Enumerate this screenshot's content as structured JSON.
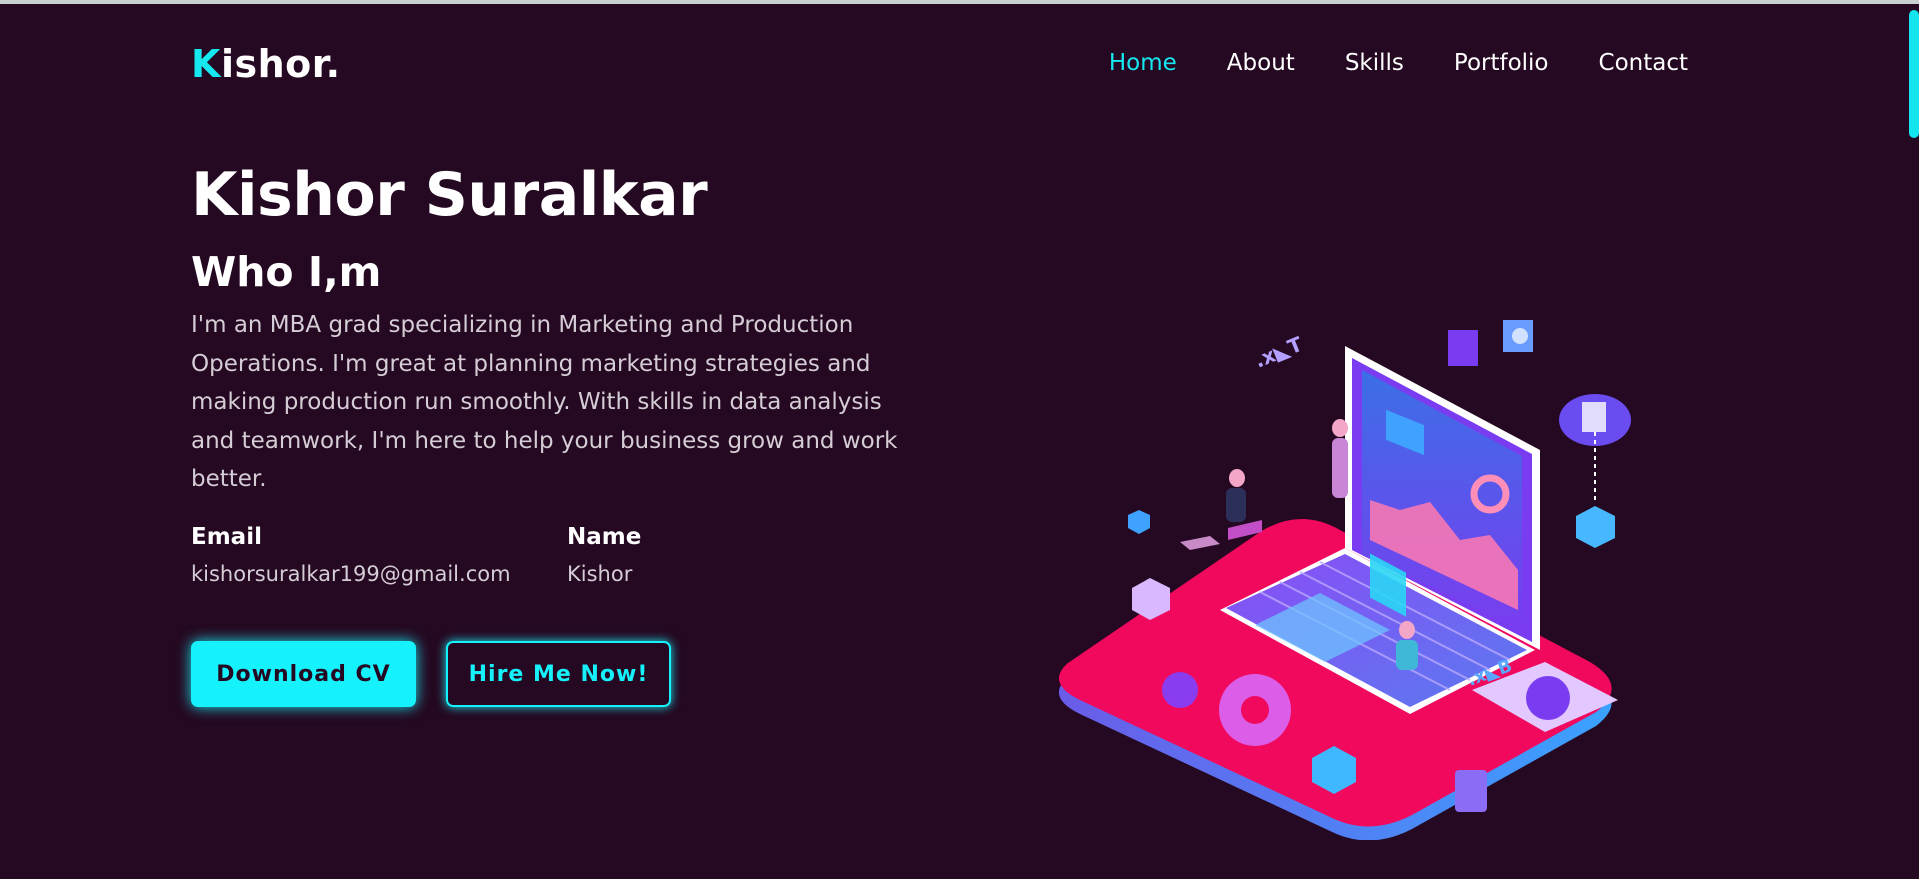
{
  "brand": {
    "first_letter": "K",
    "rest": "ishor."
  },
  "nav": {
    "items": [
      "Home",
      "About",
      "Skills",
      "Portfolio",
      "Contact"
    ],
    "active": "Home"
  },
  "hero": {
    "name": "Kishor Suralkar",
    "subtitle": "Who I,m",
    "bio": "I'm an MBA grad specializing in Marketing and Production Operations. I'm great at planning marketing strategies and making production run smoothly. With skills in data analysis and teamwork, I'm here to help your business grow and work better."
  },
  "info": {
    "email_label": "Email",
    "email_value": "kishorsuralkar199@gmail.com",
    "name_label": "Name",
    "name_value": "Kishor"
  },
  "buttons": {
    "download": "Download CV",
    "hire": "Hire Me Now!"
  },
  "colors": {
    "background": "#250821",
    "accent": "#16e8f0",
    "platform": "#f0095d",
    "laptop": "#7a3cf0"
  }
}
